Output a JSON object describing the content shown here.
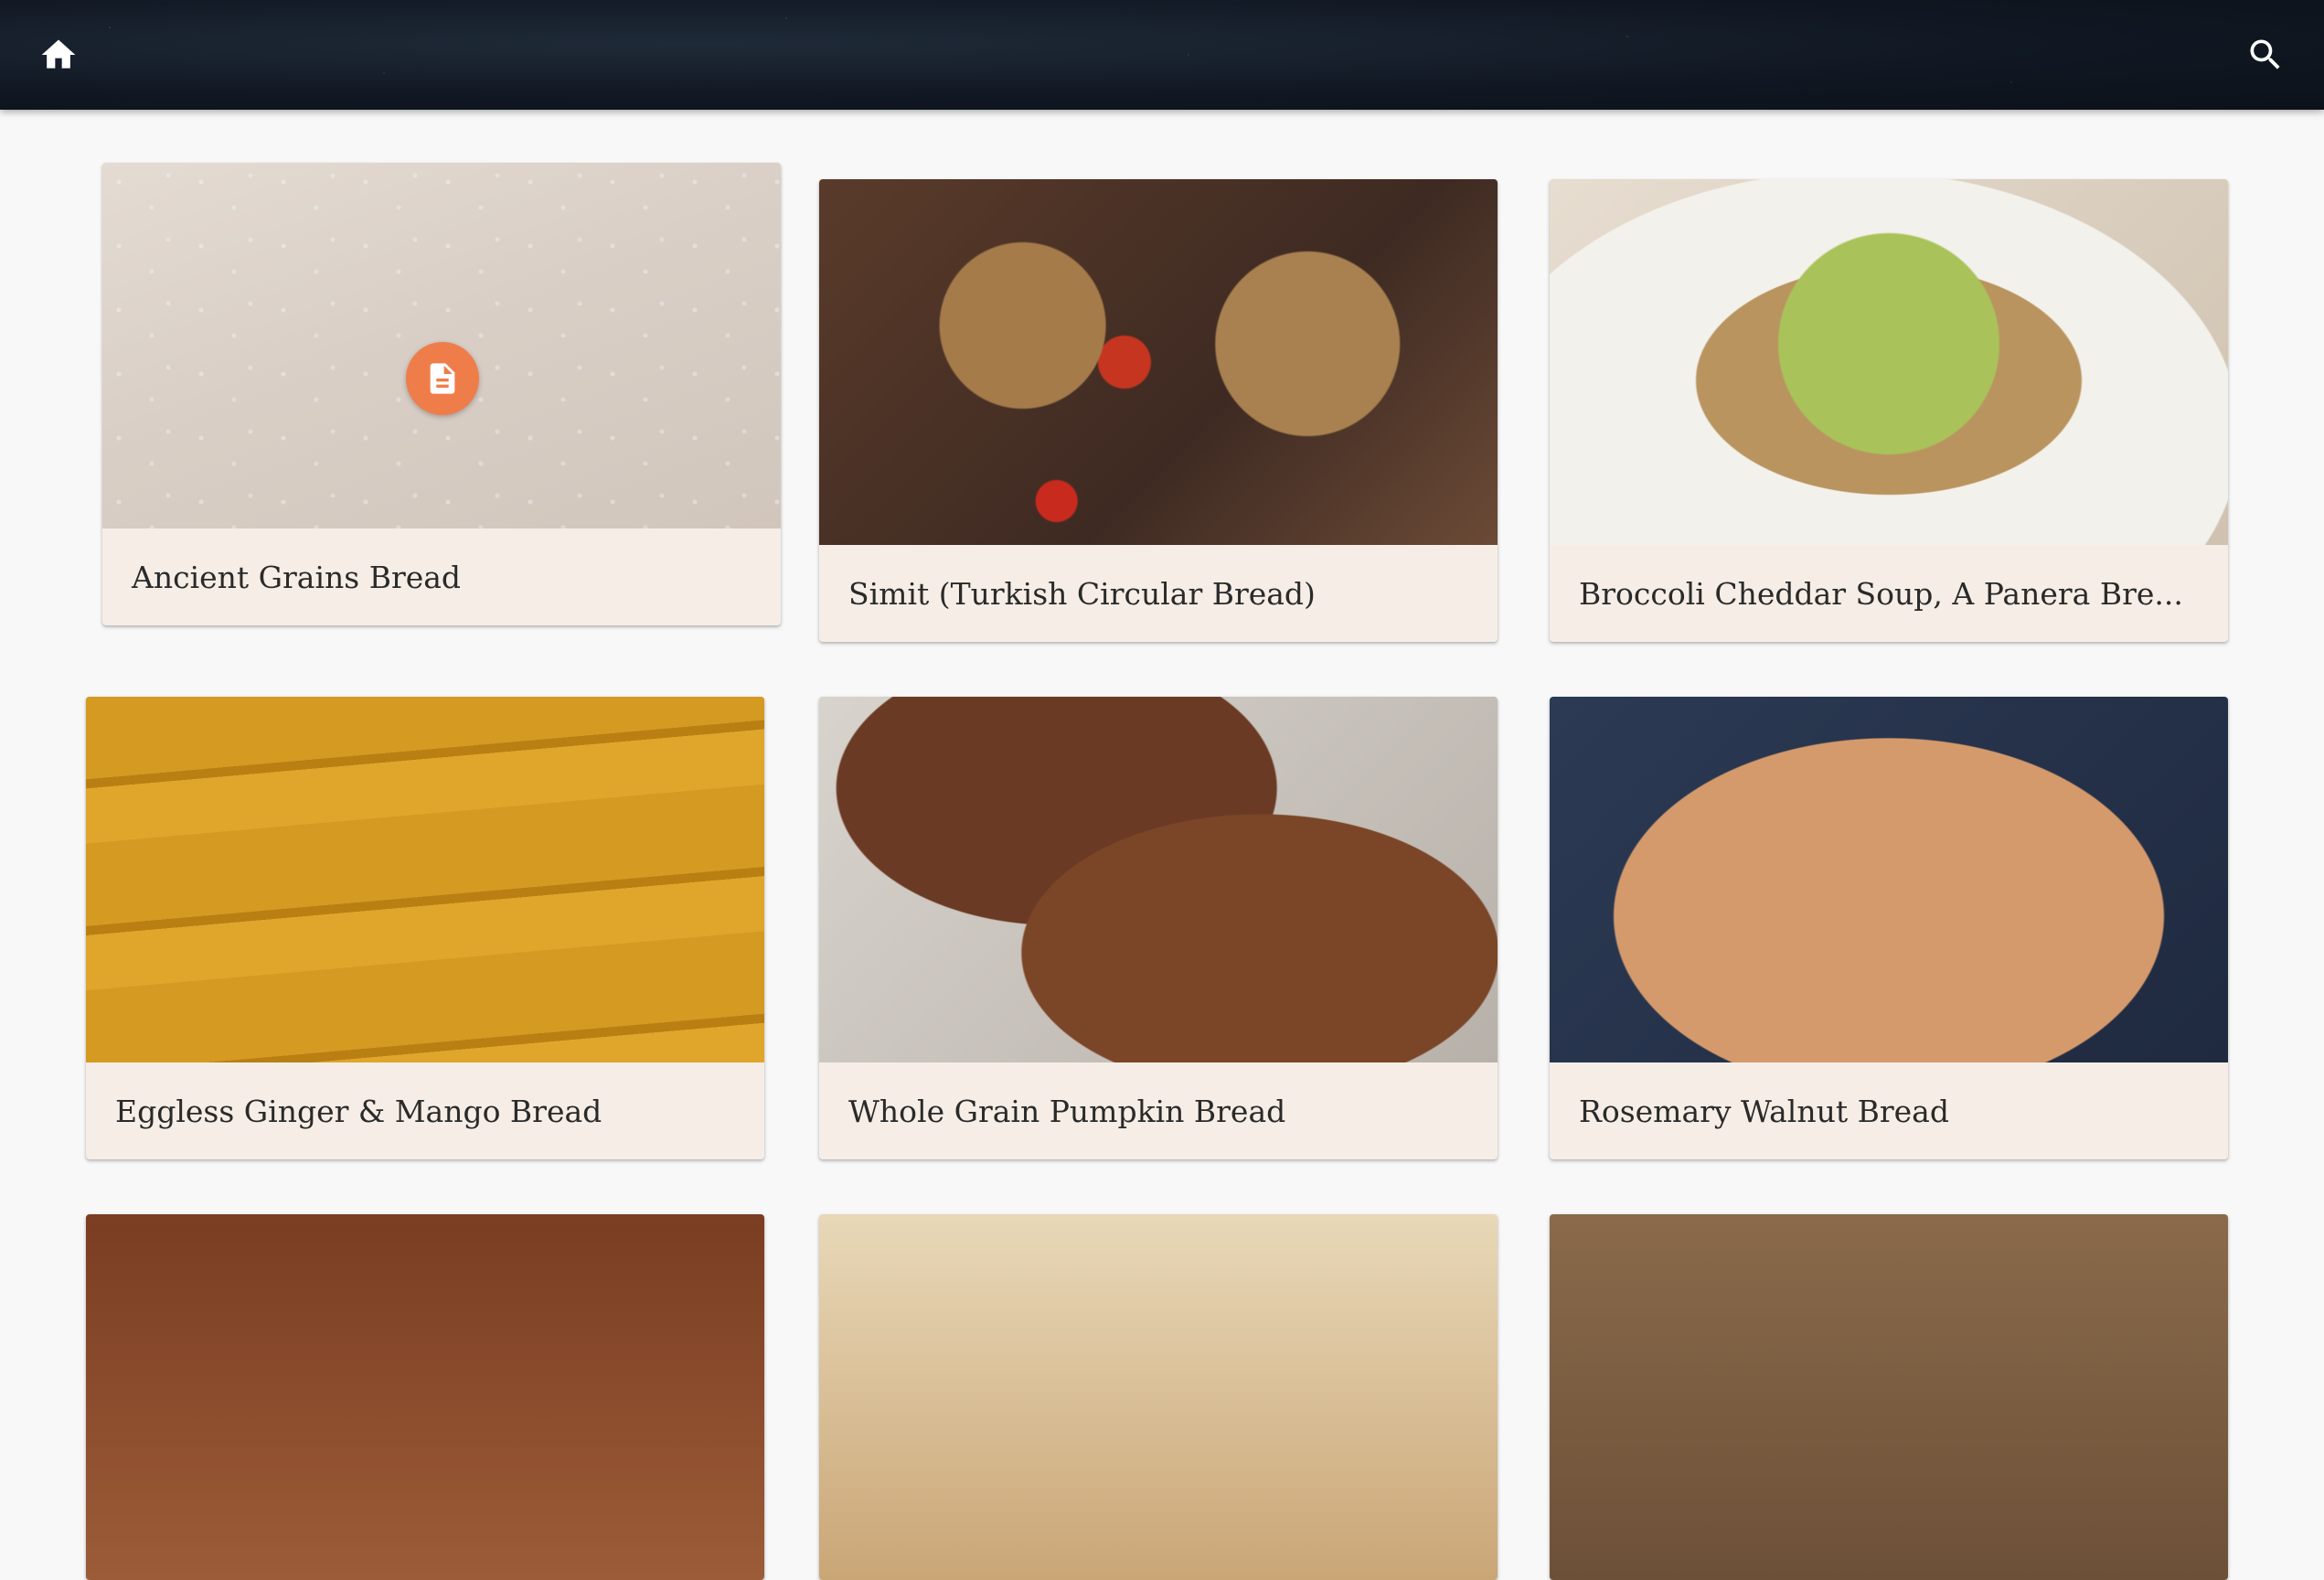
{
  "app_bar": {
    "home_icon": "home-icon",
    "search_icon": "search-icon"
  },
  "recipes": [
    {
      "title": "Ancient Grains Bread",
      "has_badge": true,
      "badge_icon": "document-icon"
    },
    {
      "title": "Simit (Turkish Circular Bread)"
    },
    {
      "title": "Broccoli Cheddar Soup, A Panera Bre..."
    },
    {
      "title": "Eggless Ginger & Mango Bread"
    },
    {
      "title": "Whole Grain Pumpkin Bread"
    },
    {
      "title": "Rosemary Walnut Bread"
    }
  ],
  "colors": {
    "accent": "#ef7d4a",
    "card_footer": "#f6eee6",
    "app_bar": "#101722",
    "background": "#f8f8f8"
  }
}
